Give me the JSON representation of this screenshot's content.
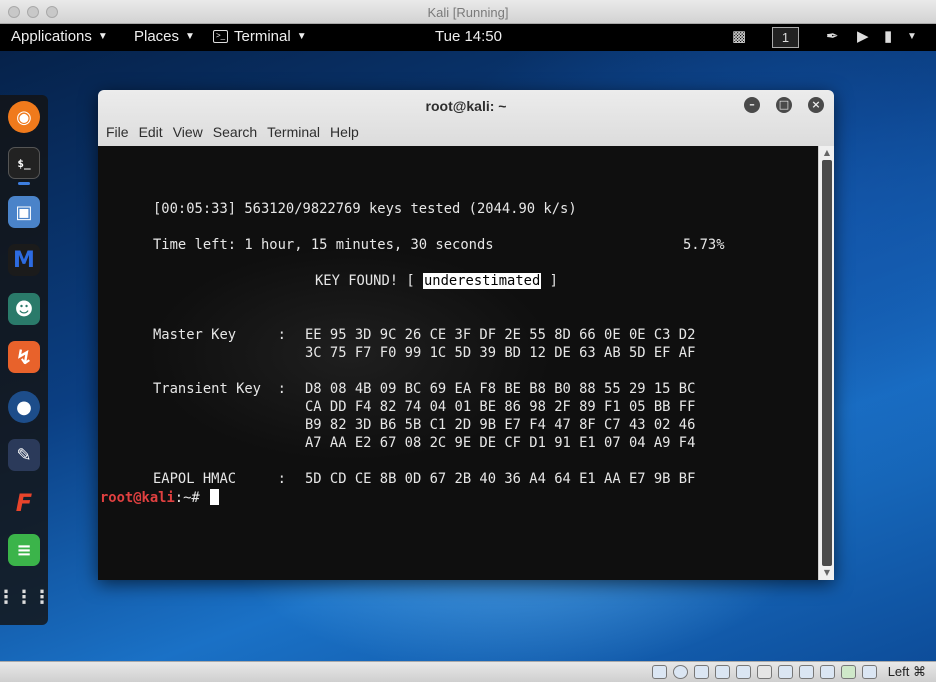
{
  "host": {
    "title": "Kali [Running]",
    "host_key": "Left ⌘"
  },
  "panel": {
    "applications": "Applications",
    "places": "Places",
    "terminal": "Terminal",
    "clock": "Tue 14:50",
    "workspace": "1"
  },
  "dock": {
    "items": [
      "firefox-icon",
      "terminal-icon",
      "files-icon",
      "metasploit-icon",
      "armitage-icon",
      "burpsuite-icon",
      "maltego-icon",
      "beef-icon",
      "faraday-icon",
      "text-editor-icon",
      "app-grid-icon"
    ]
  },
  "terminal": {
    "title": "root@kali: ~",
    "menu": [
      "File",
      "Edit",
      "View",
      "Search",
      "Terminal",
      "Help"
    ],
    "progress_line": "[00:05:33] 563120/9822769 keys tested (2044.90 k/s)",
    "time_left": "Time left: 1 hour, 15 minutes, 30 seconds",
    "percent": "5.73%",
    "key_found_prefix": "KEY FOUND! [ ",
    "key_found_value": "underestimated",
    "key_found_suffix": " ]",
    "master_key_label": "Master Key     : ",
    "master_key_1": "EE 95 3D 9C 26 CE 3F DF 2E 55 8D 66 0E 0E C3 D2",
    "master_key_2": "3C 75 F7 F0 99 1C 5D 39 BD 12 DE 63 AB 5D EF AF",
    "transient_key_label": "Transient Key  : ",
    "transient_key_1": "D8 08 4B 09 BC 69 EA F8 BE B8 B0 88 55 29 15 BC",
    "transient_key_2": "CA DD F4 82 74 04 01 BE 86 98 2F 89 F1 05 BB FF",
    "transient_key_3": "B9 82 3D B6 5B C1 2D 9B E7 F4 47 8F C7 43 02 46",
    "transient_key_4": "A7 AA E2 67 08 2C 9E DE CF D1 91 E1 07 04 A9 F4",
    "eapol_label": "EAPOL HMAC     : ",
    "eapol_value": "5D CD CE 8B 0D 67 2B 40 36 A4 64 E1 AA E7 9B BF",
    "prompt_user": "root@kali",
    "prompt_rest": ":~# "
  }
}
